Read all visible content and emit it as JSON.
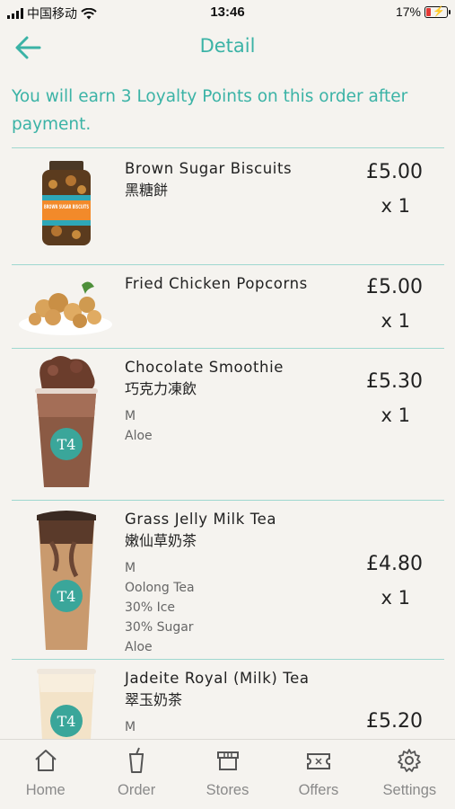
{
  "status_bar": {
    "carrier": "中国移动",
    "time": "13:46",
    "battery": "17%",
    "battery_level": 0.17
  },
  "header": {
    "title": "Detail",
    "back_icon": "arrow-left-icon"
  },
  "loyalty_message": "You will earn 3 Loyalty Points on this order after payment.",
  "colors": {
    "accent": "#3bb3a6",
    "divider": "#9fd8d0",
    "background": "#f5f3ef",
    "tab_inactive": "#8a8a8a"
  },
  "order_items": [
    {
      "name_en": "Brown Sugar Biscuits",
      "name_zh": "黑糖餅",
      "options": [],
      "price": "£5.00",
      "quantity": "x 1",
      "jar_label": "BROWN SUGAR BISCUITS"
    },
    {
      "name_en": "Fried Chicken Popcorns",
      "name_zh": "",
      "options": [],
      "price": "£5.00",
      "quantity": "x 1"
    },
    {
      "name_en": "Chocolate Smoothie",
      "name_zh": "巧克力凍飲",
      "options": [
        "M",
        "Aloe"
      ],
      "price": "£5.30",
      "quantity": "x 1",
      "cup_logo": "T4"
    },
    {
      "name_en": "Grass Jelly Milk Tea",
      "name_zh": "嫩仙草奶茶",
      "options": [
        "M",
        "Oolong Tea",
        "30% Ice",
        "30% Sugar",
        "Aloe"
      ],
      "price": "£4.80",
      "quantity": "x 1",
      "cup_logo": "T4"
    },
    {
      "name_en": "Jadeite Royal (Milk) Tea",
      "name_zh": "翠玉奶茶",
      "options": [
        "M"
      ],
      "price": "£5.20",
      "quantity": "",
      "cup_logo": "T4"
    }
  ],
  "tabbar": {
    "tabs": [
      {
        "label": "Home",
        "icon": "home-icon"
      },
      {
        "label": "Order",
        "icon": "cup-icon"
      },
      {
        "label": "Stores",
        "icon": "store-icon"
      },
      {
        "label": "Offers",
        "icon": "ticket-icon"
      },
      {
        "label": "Settings",
        "icon": "gear-icon"
      }
    ]
  }
}
